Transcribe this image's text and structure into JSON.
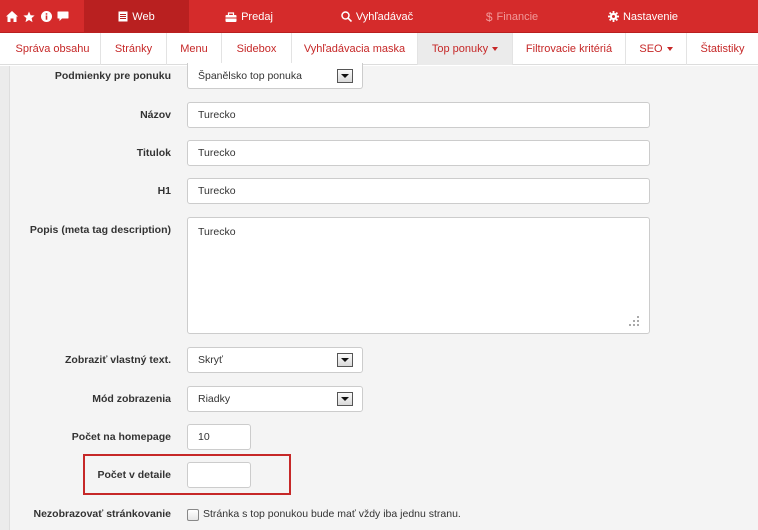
{
  "topbar": {
    "icons": [
      "home-icon",
      "star-icon",
      "info-icon",
      "chat-icon"
    ],
    "tabs": [
      {
        "label": "Web",
        "icon": "document-icon",
        "active": true
      },
      {
        "label": "Predaj",
        "icon": "cart-icon"
      },
      {
        "label": "Vyhľadávač",
        "icon": "search-icon"
      },
      {
        "label": "Financie",
        "icon": "dollar-icon",
        "disabled": true
      },
      {
        "label": "Nastavenie",
        "icon": "gear-icon"
      }
    ]
  },
  "subnav": {
    "items": [
      {
        "label": "Správa obsahu"
      },
      {
        "label": "Stránky"
      },
      {
        "label": "Menu"
      },
      {
        "label": "Sidebox"
      },
      {
        "label": "Vyhľadávacia maska"
      },
      {
        "label": "Top ponuky",
        "active": true,
        "dropdown": true
      },
      {
        "label": "Filtrovacie kritériá"
      },
      {
        "label": "SEO",
        "dropdown": true
      },
      {
        "label": "Štatistiky"
      }
    ]
  },
  "form": {
    "podmienky": {
      "label": "Podmienky pre ponuku",
      "value": "Španělsko top ponuka"
    },
    "nazov": {
      "label": "Názov",
      "value": "Turecko"
    },
    "titulok": {
      "label": "Titulok",
      "value": "Turecko"
    },
    "h1": {
      "label": "H1",
      "value": "Turecko"
    },
    "popis": {
      "label": "Popis (meta tag description)",
      "value": "Turecko"
    },
    "vlastny_text": {
      "label": "Zobraziť vlastný text.",
      "value": "Skryť"
    },
    "mod": {
      "label": "Mód zobrazenia",
      "value": "Riadky"
    },
    "pocet_homepage": {
      "label": "Počet na homepage",
      "value": "10"
    },
    "pocet_detail": {
      "label": "Počet v detaile",
      "value": ""
    },
    "nezobrazovat": {
      "label": "Nezobrazovať stránkovanie",
      "checkbox_text": "Stránka s top ponukou bude mať vždy iba jednu stranu.",
      "checked": false
    }
  },
  "colors": {
    "brand_red": "#d52b2b",
    "active_red": "#b92020",
    "highlight": "#c62828"
  }
}
